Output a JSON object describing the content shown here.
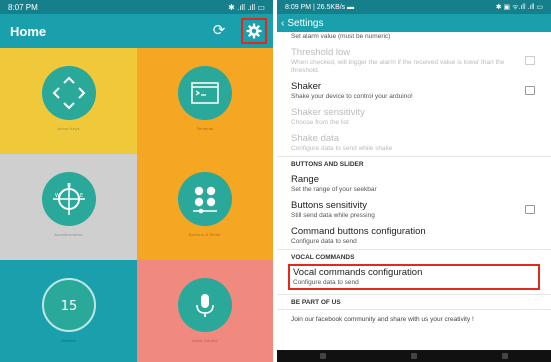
{
  "left": {
    "status_time": "8:07 PM",
    "status_icons": "✱ .ıll .ıll ▭",
    "title": "Home",
    "tiles": [
      {
        "label": "Arrow Keys",
        "icon": "arrows-icon"
      },
      {
        "label": "Terminal",
        "icon": "terminal-icon"
      },
      {
        "label": "Accelerometer",
        "icon": "compass-icon"
      },
      {
        "label": "Buttons & Slider",
        "icon": "buttons-slider-icon"
      },
      {
        "label": "Metrics",
        "icon": "timer-icon",
        "value": "15"
      },
      {
        "label": "Voice Control",
        "icon": "microphone-icon"
      }
    ]
  },
  "right": {
    "status_time": "8:09 PM | 26.5KB/s ▬",
    "status_icons": "✱ ▣ ᯤ.ıll .ıll ▭",
    "title": "Settings",
    "rows": {
      "alarm_sub": "Set alarm value (must be numeric)",
      "threshold_title": "Threshold low",
      "threshold_sub": "When checked, will trigger the alarm if the received value is lower than the threshold.",
      "shaker_title": "Shaker",
      "shaker_sub": "Shake your device to control your arduino!",
      "shaker_sens_title": "Shaker sensitivity",
      "shaker_sens_sub": "Choose from the list",
      "shake_data_title": "Shake data",
      "shake_data_sub": "Configure data to send while shake",
      "section_buttons": "BUTTONS AND SLIDER",
      "range_title": "Range",
      "range_sub": "Set the range of your seekbar",
      "btn_sens_title": "Buttons sensitivity",
      "btn_sens_sub": "Still send data while pressing",
      "cmd_title": "Command buttons configuration",
      "cmd_sub": "Configure data to send",
      "section_vocal": "VOCAL COMMANDS",
      "vocal_title": "Vocal commands configuration",
      "vocal_sub": "Configure data to send",
      "section_part": "BE PART OF US",
      "community": "Join our facebook community and share with us your creativity !"
    }
  },
  "colors": {
    "teal": "#1aa0ad",
    "highlight": "#e02a1b"
  }
}
